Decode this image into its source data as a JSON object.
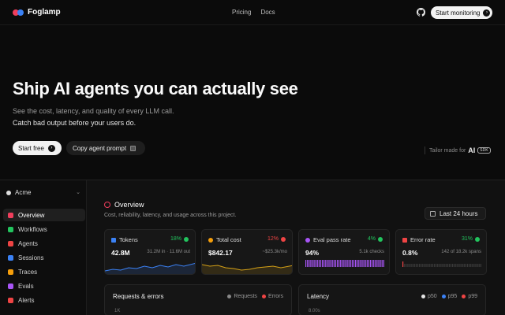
{
  "nav": {
    "brand": "Foglamp",
    "links": [
      "Pricing",
      "Docs"
    ],
    "cta": "Start monitoring"
  },
  "hero": {
    "title": "Ship AI agents you can actually see",
    "subtitle_1": "See the cost, latency, and quality of every LLM call.",
    "subtitle_2": "Catch bad output before your users do.",
    "primary_button": "Start free",
    "secondary_button": "Copy agent prompt",
    "tailor_label": "Tailor made for",
    "tailor_ai": "AI",
    "tailor_sdk": "SDK"
  },
  "sidebar": {
    "workspace": "Acme",
    "items": [
      {
        "label": "Overview",
        "color": "#ef3e5c"
      },
      {
        "label": "Workflows",
        "color": "#22c55e"
      },
      {
        "label": "Agents",
        "color": "#ef4444"
      },
      {
        "label": "Sessions",
        "color": "#3b82f6"
      },
      {
        "label": "Traces",
        "color": "#f59e0b"
      },
      {
        "label": "Evals",
        "color": "#a855f7"
      },
      {
        "label": "Alerts",
        "color": "#ef4444"
      }
    ]
  },
  "overview": {
    "title": "Overview",
    "subtitle": "Cost, reliability, latency, and usage across this project.",
    "range": "Last 24 hours"
  },
  "cards": [
    {
      "title": "Tokens",
      "delta": "18%",
      "delta_color": "#22c55e",
      "value": "42.8M",
      "meta": "31.2M in · 11.6M out",
      "icon_color": "#3b82f6",
      "line_color": "#3b82f6"
    },
    {
      "title": "Total cost",
      "delta": "12%",
      "delta_color": "#ef4444",
      "value": "$842.17",
      "meta": "~$25.3k/mo",
      "icon_color": "#f59e0b",
      "line_color": "#d4a017"
    },
    {
      "title": "Eval pass rate",
      "delta": "4%",
      "delta_color": "#22c55e",
      "value": "94%",
      "meta": "5.1k checks",
      "icon_color": "#a855f7",
      "line_color": "#a855f7"
    },
    {
      "title": "Error rate",
      "delta": "31%",
      "delta_color": "#22c55e",
      "value": "0.8%",
      "meta": "142 of 18.2k spans",
      "icon_color": "#ef4444",
      "line_color": "#ef4444"
    }
  ],
  "panels": {
    "requests": {
      "title": "Requests & errors",
      "legend": [
        "Requests",
        "Errors"
      ],
      "legend_colors": [
        "#888888",
        "#ef4444"
      ],
      "axis_top": "1K"
    },
    "latency": {
      "title": "Latency",
      "legend": [
        "p50",
        "p95",
        "p99"
      ],
      "legend_colors": [
        "#e5e5e5",
        "#3b82f6",
        "#ef4444"
      ],
      "axis_top": "8.00s"
    }
  }
}
